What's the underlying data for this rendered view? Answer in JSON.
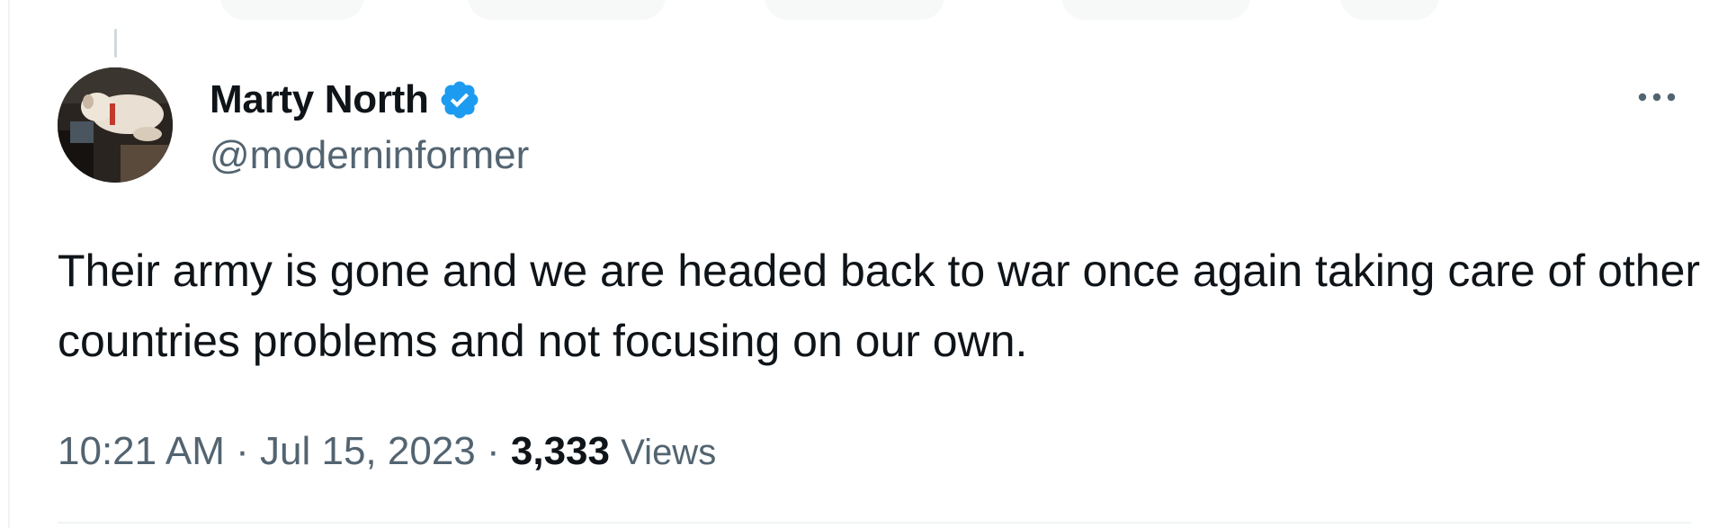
{
  "author": {
    "display_name": "Marty North",
    "handle": "@moderninformer",
    "verified": true,
    "avatar_icon": "dog-photo-avatar"
  },
  "tweet": {
    "text": "Their army is gone and we are headed back to war once again taking care of other countries problems and not focusing on our own.",
    "time": "10:21 AM",
    "separator": " · ",
    "date": "Jul 15, 2023",
    "views_count": "3,333",
    "views_label": "Views"
  },
  "icons": {
    "verified": "verified-badge-icon",
    "more": "more-options-icon"
  },
  "colors": {
    "text_primary": "#0f1419",
    "text_secondary": "#536471",
    "verified_blue": "#1d9bf0",
    "divider": "#eff3f4"
  }
}
